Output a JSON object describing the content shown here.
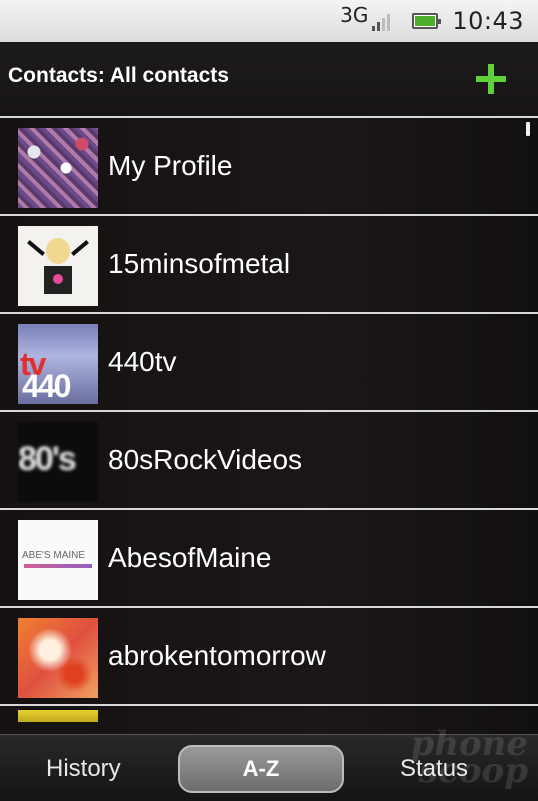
{
  "status_bar": {
    "network": "3G",
    "signal_icon": "signal-bars-icon",
    "battery_icon": "battery-icon",
    "time": "10:43"
  },
  "header": {
    "title": "Contacts: All contacts",
    "add_icon": "plus-icon",
    "accent_color": "#5fd13a"
  },
  "contacts": [
    {
      "name": "My Profile"
    },
    {
      "name": "15minsofmetal"
    },
    {
      "name": "440tv",
      "thumb_text": "440",
      "thumb_text_accent": "tv"
    },
    {
      "name": "80sRockVideos",
      "thumb_text": "80's"
    },
    {
      "name": "AbesofMaine",
      "thumb_text": "ABE'S MAINE"
    },
    {
      "name": "abrokentomorrow"
    }
  ],
  "tabs": [
    {
      "label": "History",
      "selected": false
    },
    {
      "label": "A-Z",
      "selected": true
    },
    {
      "label": "Status",
      "selected": false
    }
  ],
  "watermark": {
    "line1": "phone",
    "line2": "scoop"
  }
}
